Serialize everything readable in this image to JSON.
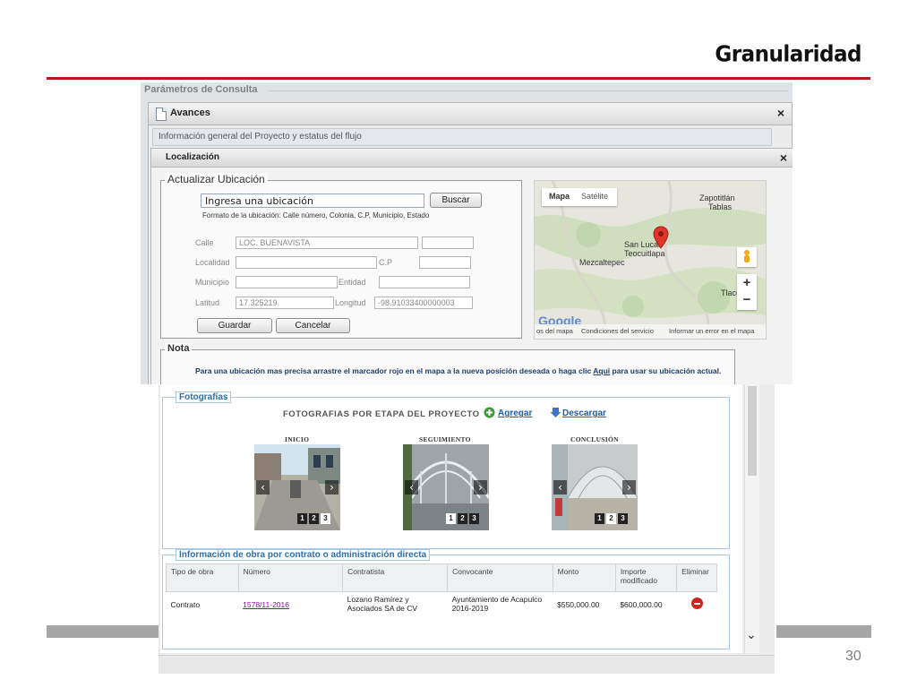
{
  "slide": {
    "title": "Granularidad",
    "page_number": "30",
    "accent_color": "#b11b1b"
  },
  "top_window": {
    "bg_section_label": "Parámetros de Consulta",
    "avances": {
      "title": "Avances",
      "close": "×",
      "info_general": "Información general del Proyecto y estatus del flujo"
    },
    "localizacion": {
      "title": "Localización",
      "close": "×",
      "actualizar_legend": "Actualizar Ubicación",
      "search_value": "Ingresa una ubicación",
      "search_button": "Buscar",
      "format_note": "Formato de la ubicación: Calle número, Colonia, C.P, Municipio, Estado",
      "labels": {
        "calle": "Calle",
        "localidad": "Localidad",
        "cp": "C.P",
        "municipio": "Municipio",
        "entidad": "Entidad",
        "latitud": "Latitud",
        "longitud": "Longitud"
      },
      "values": {
        "calle": "LOC. BUENAVISTA",
        "latitud": "17.325219",
        "longitud": "-98.91033400000003"
      },
      "guardar": "Guardar",
      "cancelar": "Cancelar",
      "map": {
        "tab_mapa": "Mapa",
        "tab_satelite": "Satélite",
        "place1": "Zapotitlán",
        "place1b": "Tablas",
        "place2": "San Lucas",
        "place2b": "Teocuitlapa",
        "place3": "Mezcaltepec",
        "place4": "Tlacc",
        "zoom_in": "+",
        "zoom_out": "−",
        "footer_a": "os del mapa",
        "footer_b": "Condiciones del servicio",
        "footer_c": "Informar un error en el mapa",
        "logo": "Google"
      },
      "nota_legend": "Nota",
      "nota_text_before": "Para una ubicación mas precisa arrastre el marcador rojo en el mapa a la nueva posición deseada o haga clic ",
      "nota_link": "Aqui",
      "nota_text_after": " para usar su ubicación actual."
    }
  },
  "bottom_window": {
    "fotos_legend": "Fotografías",
    "fotos_title": "FOTOGRAFIAS POR ETAPA DEL PROYECTO",
    "agregar": "Agregar",
    "descargar": "Descargar",
    "stages": [
      {
        "label": "INICIO",
        "pages": [
          "1",
          "2",
          "3"
        ],
        "active": "3"
      },
      {
        "label": "SEGUIMIENTO",
        "pages": [
          "1",
          "2",
          "3"
        ],
        "active": "1"
      },
      {
        "label": "CONCLUSIÓN",
        "pages": [
          "1",
          "2",
          "3"
        ],
        "active": "2"
      }
    ],
    "obra_legend": "Información de obra por contrato o administración directa",
    "table": {
      "headers": [
        "Tipo de obra",
        "Número",
        "Contratista",
        "Convocante",
        "Monto",
        "Importe modificado",
        "Eliminar"
      ],
      "rows": [
        {
          "tipo": "Contrato",
          "numero": "1578/11-2016",
          "contratista": "Lozano Ramírez y Asociados SA de CV",
          "convocante": "Ayuntamiento de Acapulco 2016-2019",
          "monto": "$550,000.00",
          "importe": "$600,000.00"
        }
      ]
    },
    "scroll_down": "⌄"
  }
}
